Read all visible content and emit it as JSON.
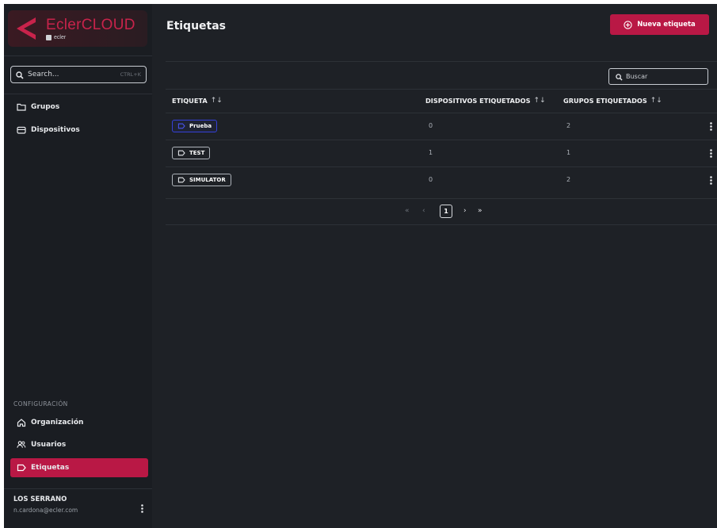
{
  "app": {
    "logo_name": "EclerCLOUD",
    "logo_sub": "ecler",
    "brand_color": "#b91845"
  },
  "sidebar": {
    "search_placeholder": "Search...",
    "search_shortcut": "CTRL+K",
    "items": [
      {
        "label": "Grupos",
        "icon": "folder-icon"
      },
      {
        "label": "Dispositivos",
        "icon": "device-icon"
      }
    ],
    "config_label": "CONFIGURACIÓN",
    "config_items": [
      {
        "label": "Organización",
        "icon": "home-icon"
      },
      {
        "label": "Usuarios",
        "icon": "users-icon"
      },
      {
        "label": "Etiquetas",
        "icon": "tag-icon",
        "active": true
      }
    ],
    "user": {
      "name": "LOS SERRANO",
      "email": "n.cardona@ecler.com"
    }
  },
  "main": {
    "title": "Etiquetas",
    "new_button": "Nueva etiqueta",
    "search_placeholder": "Buscar",
    "columns": [
      "ETIQUETA",
      "DISPOSITIVOS ETIQUETADOS",
      "GRUPOS ETIQUETADOS"
    ],
    "sort_glyph": "↑↓",
    "rows": [
      {
        "tag": "Prueba",
        "devices": "0",
        "groups": "2",
        "style": "blue"
      },
      {
        "tag": "TEST",
        "devices": "1",
        "groups": "1",
        "style": "gray"
      },
      {
        "tag": "SIMULATOR",
        "devices": "0",
        "groups": "2",
        "style": "gray"
      }
    ],
    "pagination": {
      "first": "«",
      "prev": "‹",
      "current": "1",
      "next": "›",
      "last": "»"
    }
  }
}
